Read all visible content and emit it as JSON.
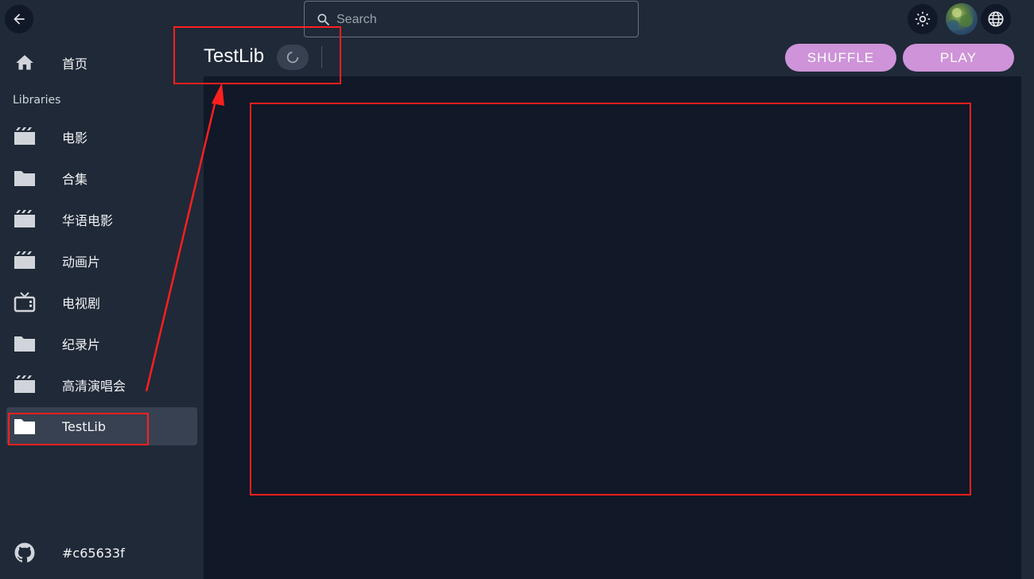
{
  "sidebar": {
    "section_label": "Libraries",
    "home": {
      "label": "首页",
      "icon": "home-icon"
    },
    "items": [
      {
        "label": "电影",
        "icon": "movie-icon"
      },
      {
        "label": "合集",
        "icon": "folder-icon"
      },
      {
        "label": "华语电影",
        "icon": "movie-icon"
      },
      {
        "label": "动画片",
        "icon": "movie-icon"
      },
      {
        "label": "电视剧",
        "icon": "tv-icon"
      },
      {
        "label": "纪录片",
        "icon": "folder-icon"
      },
      {
        "label": "高清演唱会",
        "icon": "movie-icon"
      },
      {
        "label": "TestLib",
        "icon": "folder-icon",
        "active": true
      }
    ],
    "footer": {
      "label": "#c65633f",
      "icon": "github-icon"
    }
  },
  "header": {
    "search_placeholder": "Search",
    "title": "TestLib",
    "shuffle_label": "SHUFFLE",
    "play_label": "PLAY"
  },
  "colors": {
    "accent": "#ce93d8",
    "sidebar_bg": "#1f2937",
    "content_bg": "#111827",
    "annotation": "#ff1f1f"
  }
}
